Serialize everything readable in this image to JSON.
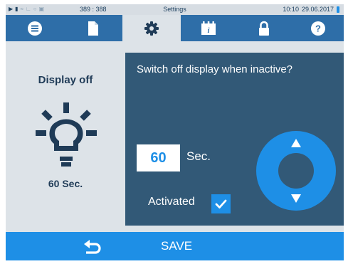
{
  "status_bar": {
    "icons": [
      "play-icon",
      "file-icon",
      "heating-icon",
      "chart-icon",
      "clock-icon",
      "lock-icon"
    ],
    "coordinates": "389 : 388",
    "title": "Settings",
    "time": "10:10",
    "date": "29.06.2017"
  },
  "tabs": [
    {
      "icon": "menu-list-icon",
      "active": false
    },
    {
      "icon": "document-icon",
      "active": false
    },
    {
      "icon": "gear-icon",
      "active": true
    },
    {
      "icon": "info-card-icon",
      "active": false
    },
    {
      "icon": "lock-icon",
      "active": false
    },
    {
      "icon": "help-icon",
      "active": false
    }
  ],
  "info": {
    "title": "Display off",
    "icon": "lightbulb-icon",
    "value": "60 Sec."
  },
  "setting": {
    "question": "Switch off display when inactive?",
    "value": "60",
    "unit": "Sec.",
    "checkbox_label": "Activated",
    "checked": true
  },
  "bottom": {
    "save_label": "SAVE",
    "back_icon": "back-arrow-icon"
  },
  "colors": {
    "tab_bar": "#2e6ea8",
    "panel": "#325977",
    "accent": "#1e8fe6",
    "background": "#dde3e8",
    "dark_text": "#1f3b57"
  }
}
